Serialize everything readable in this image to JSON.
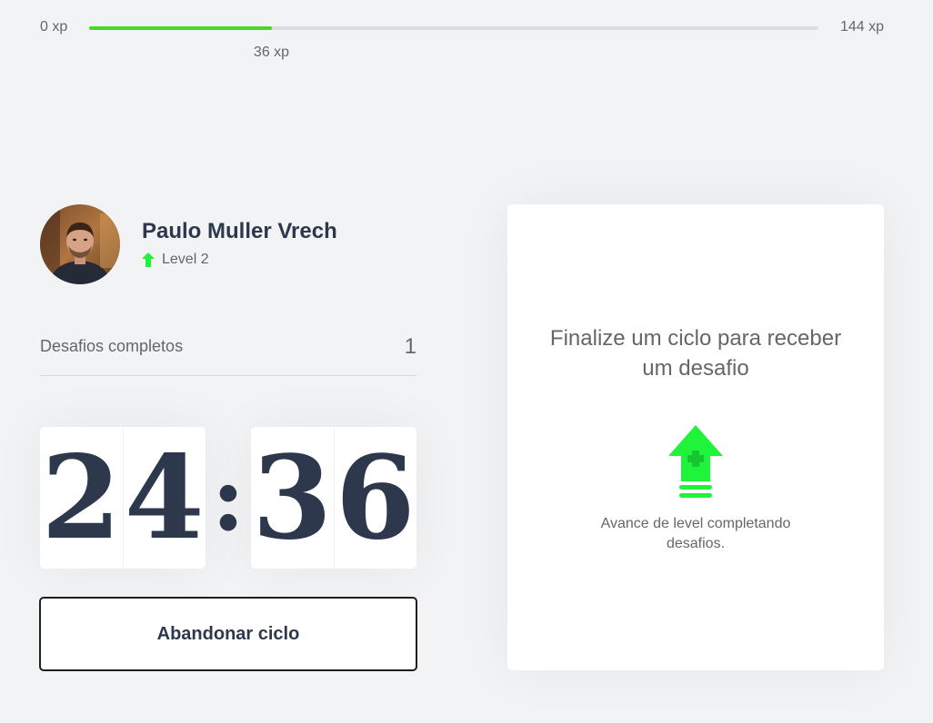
{
  "xp": {
    "min_label": "0 xp",
    "max_label": "144 xp",
    "current_label": "36 xp",
    "current": 36,
    "max": 144
  },
  "profile": {
    "name": "Paulo Muller Vrech",
    "level_label": "Level 2",
    "level_icon": "level-up-icon",
    "avatar_icon": "user-avatar"
  },
  "completed_challenges": {
    "label": "Desafios completos",
    "value": "1"
  },
  "countdown": {
    "minute_left": "2",
    "minute_right": "4",
    "separator": ":",
    "second_left": "3",
    "second_right": "6"
  },
  "actions": {
    "abandon_label": "Abandonar ciclo"
  },
  "challenge": {
    "title": "Finalize um ciclo para receber um desafio",
    "hint": "Avance de level completando desafios.",
    "icon": "level-up-icon"
  },
  "colors": {
    "background": "#f2f3f5",
    "accent_green": "#4cd62b",
    "icon_green": "#1ff43a",
    "title_text": "#2e384d",
    "body_text": "#666666"
  }
}
